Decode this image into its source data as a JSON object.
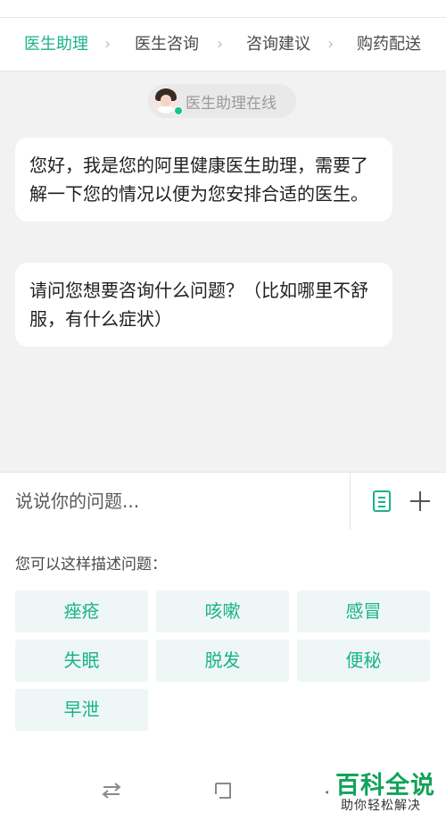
{
  "steps": [
    {
      "label": "医生助理",
      "active": true
    },
    {
      "label": "医生咨询",
      "active": false
    },
    {
      "label": "咨询建议",
      "active": false
    },
    {
      "label": "购药配送",
      "active": false
    }
  ],
  "chevron_glyph": "›",
  "chat": {
    "online_status": "医生助理在线",
    "messages": [
      "您好，我是您的阿里健康医生助理，需要了解一下您的情况以便为您安排合适的医生。",
      "请问您想要咨询什么问题？（比如哪里不舒服，有什么症状）"
    ]
  },
  "input": {
    "placeholder": "说说你的问题..."
  },
  "suggestions": {
    "title": "您可以这样描述问题：",
    "items": [
      "痤疮",
      "咳嗽",
      "感冒",
      "失眠",
      "脱发",
      "便秘",
      "早泄"
    ]
  },
  "watermark": {
    "brand": "百科全说",
    "slogan": "助你轻松解决"
  },
  "colors": {
    "accent": "#19b38a",
    "chat_background": "#f2f2f2",
    "chip_background": "#eef7f6",
    "online_dot": "#19c38a",
    "watermark_green": "#12a35a"
  },
  "icons": {
    "steps": "chevron-right-icon",
    "input_left": "document-icon",
    "input_right": "plus-icon",
    "nav_left": "switch-arrows-icon",
    "nav_center": "home-square-icon"
  }
}
